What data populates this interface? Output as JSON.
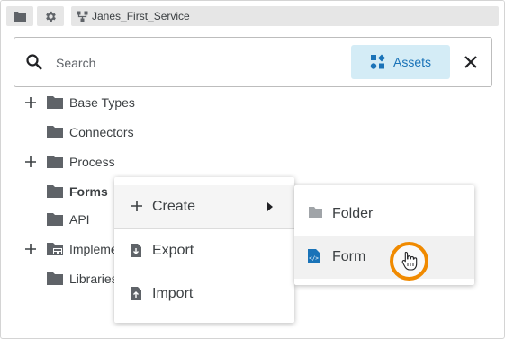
{
  "topbar": {
    "folder_icon": "folder-icon",
    "settings_icon": "gear-icon",
    "service_icon": "service-branch-icon",
    "service_name": "Janes_First_Service"
  },
  "search": {
    "placeholder": "Search",
    "value": "",
    "assets_label": "Assets",
    "assets_icon": "assets-shapes-icon",
    "close_icon": "close-icon"
  },
  "tree": {
    "items": [
      {
        "label": "Base Types",
        "expandable": true
      },
      {
        "label": "Connectors",
        "expandable": false
      },
      {
        "label": "Process",
        "expandable": true
      },
      {
        "label": "Forms",
        "expandable": false,
        "bold": true
      },
      {
        "label": "API",
        "expandable": false
      },
      {
        "label": "Impleme",
        "expandable": true
      },
      {
        "label": "Libraries",
        "expandable": false
      }
    ]
  },
  "context_menu": {
    "items": [
      {
        "label": "Create",
        "icon": "plus-icon",
        "has_submenu": true
      },
      {
        "label": "Export",
        "icon": "export-file-icon"
      },
      {
        "label": "Import",
        "icon": "import-file-icon"
      }
    ]
  },
  "submenu": {
    "items": [
      {
        "label": "Folder",
        "icon": "folder-icon"
      },
      {
        "label": "Form",
        "icon": "form-file-icon"
      }
    ]
  },
  "colors": {
    "accent": "#1a73b8",
    "assets_bg": "#d4ecf6",
    "folder_grey": "#5f6368",
    "cursor_ring": "#f08a00"
  }
}
